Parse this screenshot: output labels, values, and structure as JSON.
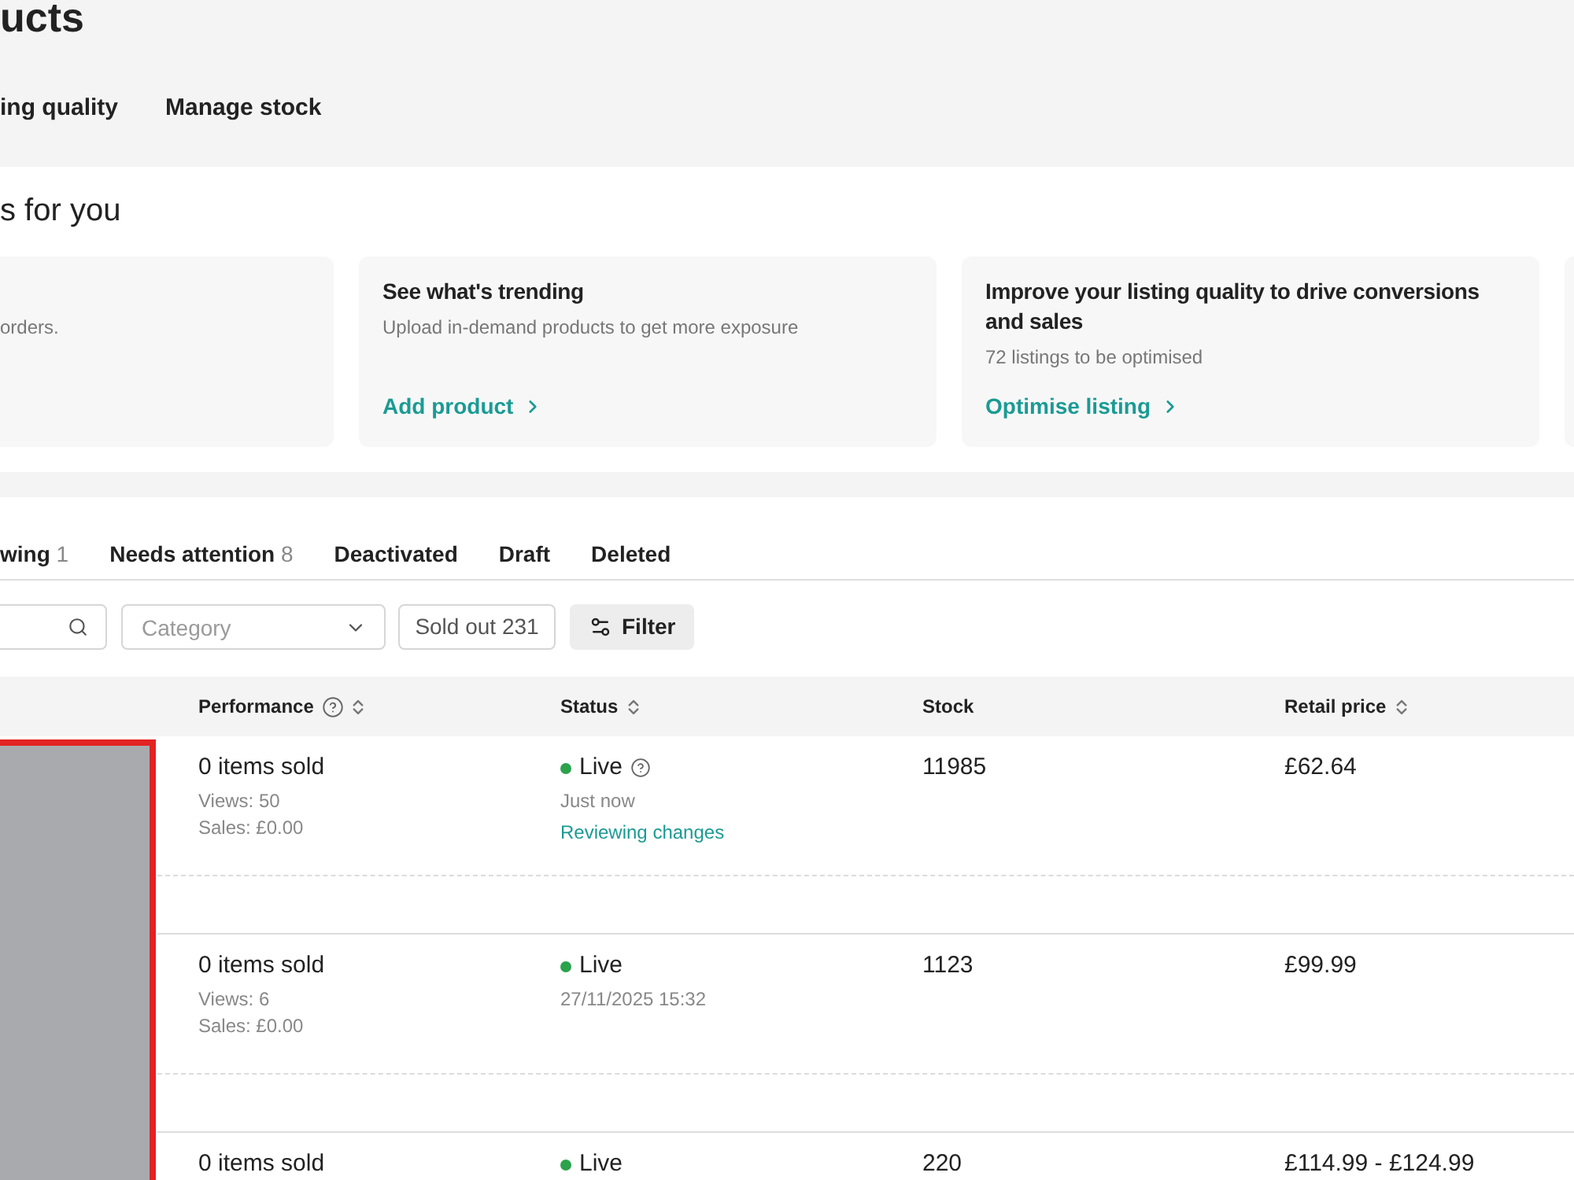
{
  "page": {
    "title": "ucts"
  },
  "header_tabs": [
    {
      "label": "ing quality",
      "selected": false
    },
    {
      "label": "Manage stock",
      "selected": false
    }
  ],
  "recommendations": {
    "heading": "s for you",
    "cards": [
      {
        "description": "orders."
      },
      {
        "title": "See what's trending",
        "description": "Upload in-demand products to get more exposure",
        "action": "Add product"
      },
      {
        "title": "Improve your listing quality to drive conversions and sales",
        "description": "72 listings to be optimised",
        "action": "Optimise listing"
      }
    ]
  },
  "status_tabs": [
    {
      "label": "wing",
      "count": "1",
      "selected": false
    },
    {
      "label": "Needs attention",
      "count": "8",
      "selected": false
    },
    {
      "label": "Deactivated",
      "selected": false
    },
    {
      "label": "Draft",
      "selected": false
    },
    {
      "label": "Deleted",
      "selected": false
    }
  ],
  "filters": {
    "category": {
      "placeholder": "Category"
    },
    "sold_out": {
      "label": "Sold out 231"
    },
    "filter": {
      "label": "Filter"
    }
  },
  "table": {
    "columns": [
      {
        "label": "Performance",
        "help": true,
        "sortable": true
      },
      {
        "label": "Status",
        "help": false,
        "sortable": true
      },
      {
        "label": "Stock",
        "help": false,
        "sortable": false
      },
      {
        "label": "Retail price",
        "help": false,
        "sortable": true
      }
    ],
    "rows": [
      {
        "sold": "0 items sold",
        "views": "Views: 50",
        "sales": "Sales: £0.00",
        "status": {
          "label": "Live",
          "help": true,
          "time": "Just now",
          "note": "Reviewing changes"
        },
        "stock": "11985",
        "price": "£62.64"
      },
      {
        "sold": "0 items sold",
        "views": "Views: 6",
        "sales": "Sales: £0.00",
        "status": {
          "label": "Live",
          "help": false,
          "time": "27/11/2025 15:32"
        },
        "stock": "1123",
        "price": "£99.99"
      },
      {
        "sold": "0 items sold",
        "status": {
          "label": "Live",
          "help": false
        },
        "stock": "220",
        "price": "£114.99 - £124.99"
      }
    ]
  }
}
